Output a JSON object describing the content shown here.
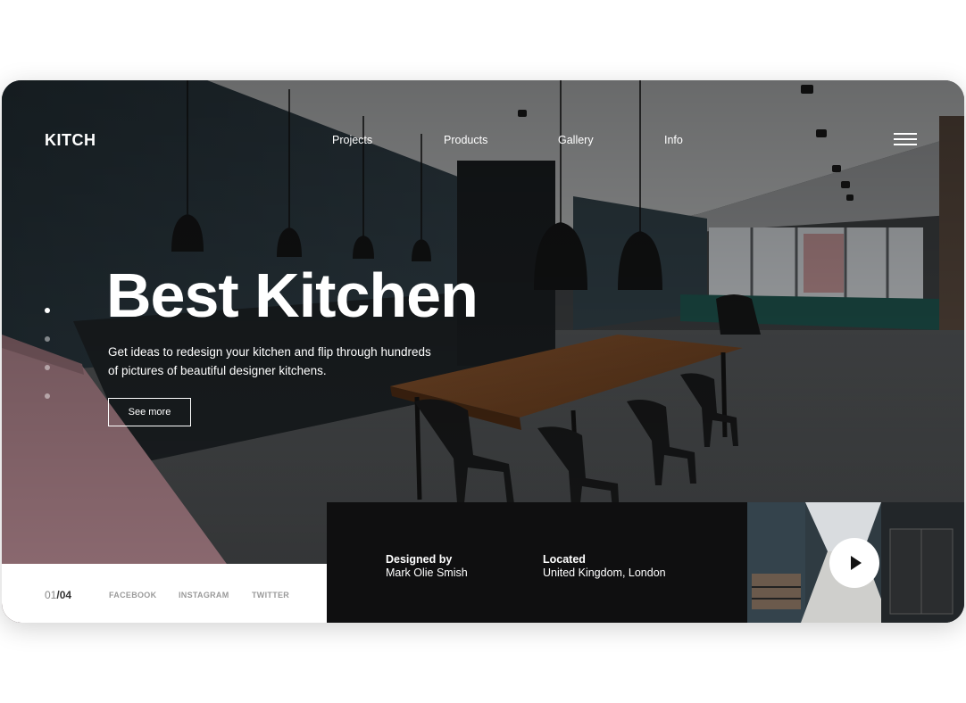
{
  "brand": {
    "logo": "KITCH"
  },
  "nav": {
    "links": [
      "Projects",
      "Products",
      "Gallery",
      "Info"
    ]
  },
  "hero": {
    "title": "Best Kitchen",
    "description_line1": "Get ideas to redesign your kitchen and flip through hundreds",
    "description_line2": "of pictures of beautiful designer kitchens.",
    "cta_label": "See more"
  },
  "slider": {
    "current": "01",
    "separator": "/",
    "total": "04",
    "dot_count": 4,
    "active_dot": 1
  },
  "social": [
    "FACEBOOK",
    "INSTAGRAM",
    "TWITTER"
  ],
  "details": {
    "designed_label": "Designed by",
    "designed_value": "Mark Olie Smish",
    "located_label": "Located",
    "located_value": "United Kingdom, London"
  },
  "icons": {
    "menu": "hamburger-menu-icon",
    "play": "play-icon"
  },
  "colors": {
    "info_bar": "#0f0f10",
    "accent_wall": "#34434c",
    "table_wood": "#7a4a26",
    "bench": "#a87f87"
  }
}
